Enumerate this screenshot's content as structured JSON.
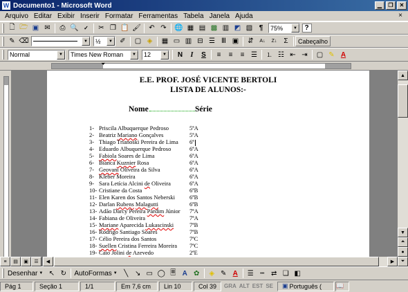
{
  "window": {
    "title": "Documento1 - Microsoft Word",
    "app_icon": "W"
  },
  "menu": {
    "items": [
      "Arquivo",
      "Editar",
      "Exibir",
      "Inserir",
      "Formatar",
      "Ferramentas",
      "Tabela",
      "Janela",
      "Ajuda"
    ],
    "help_icon": "×"
  },
  "toolbar_standard": {
    "zoom": "75%",
    "help_glyph": "?"
  },
  "toolbar_drawing_format": {
    "line_weight": "½",
    "style_value": "Cabeçalho"
  },
  "toolbar_formatting": {
    "style": "Normal",
    "font": "Times New Roman",
    "size": "12",
    "bold": "N",
    "italic": "I",
    "underline": "S"
  },
  "document": {
    "heading1": "E.E. PROF. JOSÉ VICENTE BERTOLI",
    "heading2": "LISTA DE ALUNOS:-",
    "col_name": "Nome",
    "col_serie": "Série",
    "students": [
      {
        "n": "1-",
        "name": "Priscila Albuquerque Pedroso",
        "serie": "5ªA"
      },
      {
        "n": "2-",
        "name": "Beatriz Mariano Gonçalves",
        "serie": "5ªA"
      },
      {
        "n": "3-",
        "name": "Thiago Trianoski Pereira de Lima",
        "serie": "6ª"
      },
      {
        "n": "4-",
        "name": "Eduardo Albuquerque Pedroso",
        "serie": "6ªA"
      },
      {
        "n": "5-",
        "name": "Fabiola Soares de Lima",
        "serie": "6ªA"
      },
      {
        "n": "6-",
        "name": "Bianca Kuznier Rosa",
        "serie": "6ªA"
      },
      {
        "n": "7-",
        "name": "Geovani Oliveira da Silva",
        "serie": "6ªA"
      },
      {
        "n": "8-",
        "name": "Kleber Moreira",
        "serie": "6ªA"
      },
      {
        "n": "9-",
        "name": "Sara Letícia Alcini de Oliveira",
        "serie": "6ªA"
      },
      {
        "n": "10-",
        "name": "Cristiane da Costa",
        "serie": "6ªB"
      },
      {
        "n": "11-",
        "name": "Elen Karen dos Santos Neberski",
        "serie": "6ªB"
      },
      {
        "n": "12-",
        "name": "Darlan Rubens Malagutti",
        "serie": "6ªB"
      },
      {
        "n": "13-",
        "name": "Adão Darcy Pereira Pardim Júnior",
        "serie": "7ªA"
      },
      {
        "n": "14-",
        "name": "Fabiana de Oliveira",
        "serie": "7ªA"
      },
      {
        "n": "15-",
        "name": "Mariane Aparecida Lukascinski",
        "serie": "7ªB"
      },
      {
        "n": "16-",
        "name": "Rodrigo Santiago Soares",
        "serie": "7ªB"
      },
      {
        "n": "17-",
        "name": "Célio Pereira dos Santos",
        "serie": "7ªC"
      },
      {
        "n": "18-",
        "name": "Suellen Cristina Ferreira Moreira",
        "serie": "7ªC"
      },
      {
        "n": "19-",
        "name": "Caio Jolini de Azevedo",
        "serie": "2ªE"
      }
    ]
  },
  "drawing_toolbar": {
    "draw_label": "Desenhar",
    "autoshapes_label": "AutoFormas"
  },
  "status": {
    "page": "Pág 1",
    "section": "Seção 1",
    "pages": "1/1",
    "position": "Em 7,6 cm",
    "line": "Lin 10",
    "col": "Col 39",
    "rec": "GRA",
    "trk": "ALT",
    "ext": "EST",
    "ovr": "SE",
    "language": "Português ("
  }
}
